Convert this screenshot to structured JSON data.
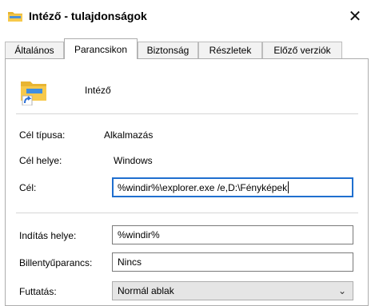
{
  "window": {
    "title": "Intéző - tulajdonságok",
    "close_glyph": "✕"
  },
  "tabs": [
    {
      "label": "Általános"
    },
    {
      "label": "Parancsikon"
    },
    {
      "label": "Biztonság"
    },
    {
      "label": "Részletek"
    },
    {
      "label": "Előző verziók"
    }
  ],
  "active_tab": "Parancsikon",
  "shortcut": {
    "name": "Intéző",
    "icon": "folder-shortcut-icon"
  },
  "info": {
    "target_type_label": "Cél típusa:",
    "target_type_value": "Alkalmazás",
    "target_location_label": "Cél helye:",
    "target_location_value": "Windows",
    "target_label": "Cél:",
    "target_value": "%windir%\\explorer.exe /e,D:\\Fényképek"
  },
  "start": {
    "start_in_label": "Indítás helye:",
    "start_in_value": "%windir%",
    "hotkey_label": "Billentyűparancs:",
    "hotkey_value": "Nincs",
    "run_label": "Futtatás:",
    "run_value": "Normál ablak"
  },
  "colors": {
    "focus_border": "#1f6fcf",
    "folder_yellow": "#f7c94b",
    "shortcut_arrow_blue": "#2a6fd6"
  }
}
